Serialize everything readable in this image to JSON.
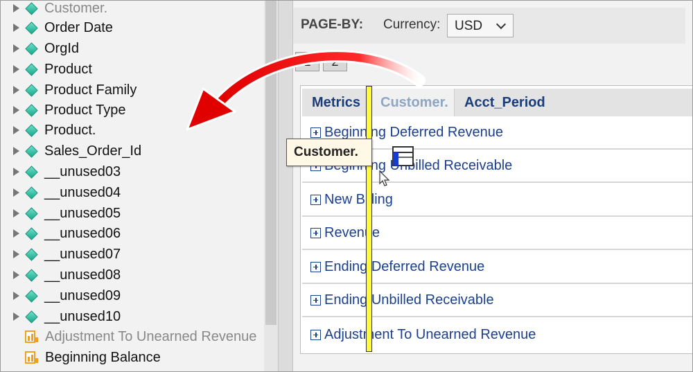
{
  "tree": {
    "items": [
      {
        "label": "Customer.",
        "kind": "attribute",
        "muted": true
      },
      {
        "label": "Order Date",
        "kind": "attribute"
      },
      {
        "label": "OrgId",
        "kind": "attribute"
      },
      {
        "label": "Product",
        "kind": "attribute"
      },
      {
        "label": "Product Family",
        "kind": "attribute"
      },
      {
        "label": "Product Type",
        "kind": "attribute"
      },
      {
        "label": "Product.",
        "kind": "attribute"
      },
      {
        "label": "Sales_Order_Id",
        "kind": "attribute"
      },
      {
        "label": "__unused03",
        "kind": "attribute"
      },
      {
        "label": "__unused04",
        "kind": "attribute"
      },
      {
        "label": "__unused05",
        "kind": "attribute"
      },
      {
        "label": "__unused06",
        "kind": "attribute"
      },
      {
        "label": "__unused07",
        "kind": "attribute"
      },
      {
        "label": "__unused08",
        "kind": "attribute"
      },
      {
        "label": "__unused09",
        "kind": "attribute"
      },
      {
        "label": "__unused10",
        "kind": "attribute"
      },
      {
        "label": "Adjustment To Unearned Revenue",
        "kind": "metric",
        "muted": true
      },
      {
        "label": "Beginning Balance",
        "kind": "metric"
      }
    ]
  },
  "pageby": {
    "label": "PAGE-BY:",
    "currency_label": "Currency:",
    "currency_value": "USD"
  },
  "pages": [
    "1",
    "2"
  ],
  "grid": {
    "headers": [
      "Metrics",
      "Customer.",
      "Acct_Period"
    ],
    "rows": [
      "Beginning Deferred Revenue",
      "Beginning Unbilled Receivable",
      "New Billing",
      "Revenue",
      "Ending Deferred Revenue",
      "Ending Unbilled Receivable",
      "Adjustment To Unearned Revenue"
    ]
  },
  "drag": {
    "tooltip": "Customer."
  },
  "colors": {
    "attribute_icon": "#1fbf9f",
    "metric_icon": "#f0a020",
    "grid_text": "#1b3f8f",
    "drop_indicator": "#fffa3a",
    "arrow": "#e01010"
  }
}
